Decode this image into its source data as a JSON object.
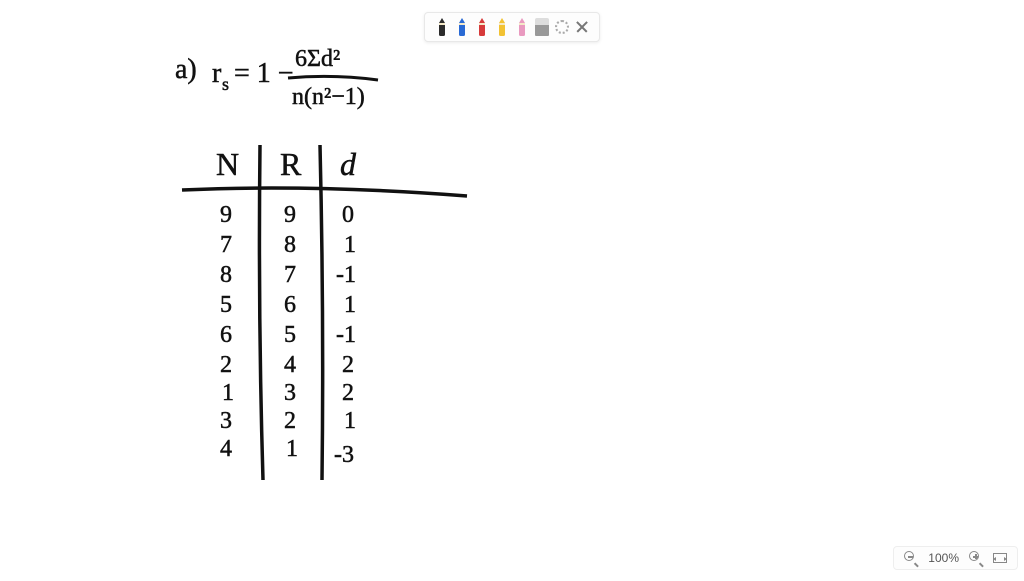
{
  "toolbar": {
    "pens": [
      {
        "name": "pen-black",
        "color": "#2b2b2b"
      },
      {
        "name": "pen-blue",
        "color": "#2a6ad4"
      },
      {
        "name": "pen-red",
        "color": "#d63a3a"
      },
      {
        "name": "pen-yellow",
        "color": "#f2c233"
      },
      {
        "name": "pen-pink",
        "color": "#e99ac0"
      }
    ]
  },
  "content": {
    "part": "a)",
    "formula_lhs": "r",
    "formula_sub": "s",
    "formula_eq": "= 1 −",
    "numerator": "6Σd²",
    "denominator": "n(n²−1)",
    "table": {
      "headers": [
        "N",
        "R",
        "d"
      ],
      "rows": [
        [
          9,
          9,
          0
        ],
        [
          7,
          8,
          1
        ],
        [
          8,
          7,
          -1
        ],
        [
          5,
          6,
          1
        ],
        [
          6,
          5,
          -1
        ],
        [
          2,
          4,
          2
        ],
        [
          1,
          3,
          2
        ],
        [
          3,
          2,
          1
        ],
        [
          4,
          1,
          -3
        ]
      ]
    }
  },
  "zoom": {
    "level": "100%"
  },
  "chart_data": {
    "type": "table",
    "title": "Spearman rank differences",
    "columns": [
      "N",
      "R",
      "d"
    ],
    "rows": [
      [
        9,
        9,
        0
      ],
      [
        7,
        8,
        1
      ],
      [
        8,
        7,
        -1
      ],
      [
        5,
        6,
        1
      ],
      [
        6,
        5,
        -1
      ],
      [
        2,
        4,
        2
      ],
      [
        1,
        3,
        2
      ],
      [
        3,
        2,
        1
      ],
      [
        4,
        1,
        -3
      ]
    ],
    "formula": "r_s = 1 - 6Σd² / (n(n²−1))"
  }
}
